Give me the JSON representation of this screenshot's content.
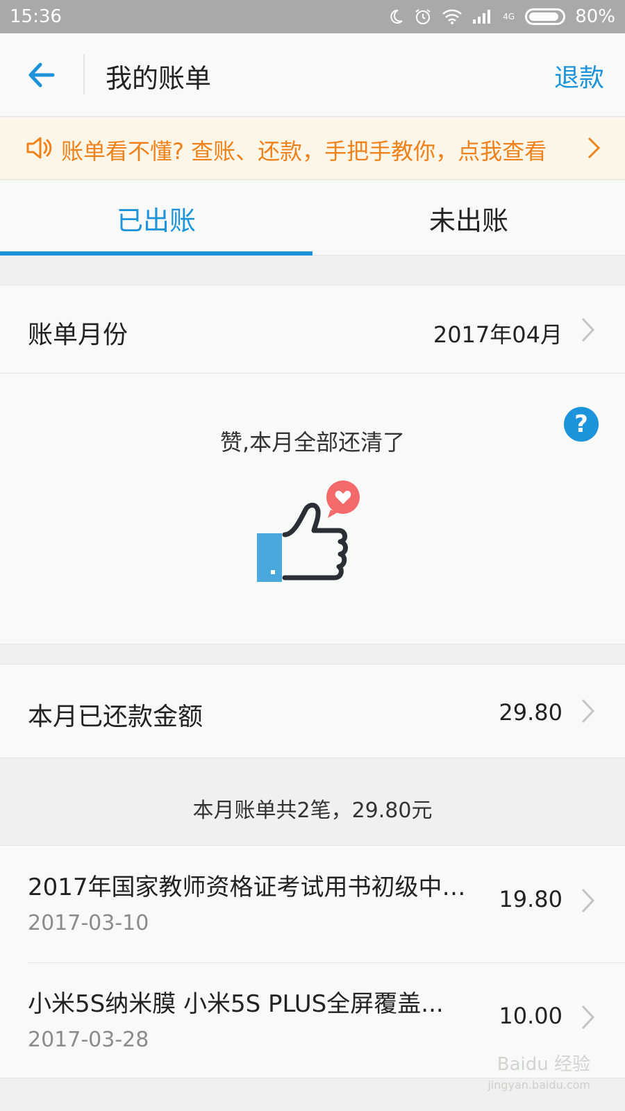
{
  "status_bar": {
    "time": "15:36",
    "network": "4G",
    "battery": "80%"
  },
  "header": {
    "title": "我的账单",
    "refund_label": "退款"
  },
  "notice": {
    "text": "账单看不懂? 查账、还款，手把手教你，点我查看"
  },
  "tabs": [
    {
      "label": "已出账",
      "active": true
    },
    {
      "label": "未出账",
      "active": false
    }
  ],
  "bill_month": {
    "label": "账单月份",
    "value": "2017年04月"
  },
  "status": {
    "message": "赞,本月全部还清了",
    "help_label": "?"
  },
  "paid_amount": {
    "label": "本月已还款金额",
    "value": "29.80"
  },
  "summary": "本月账单共2笔，29.80元",
  "bills": [
    {
      "name": "2017年国家教师资格证考试用书初级中学...",
      "date": "2017-03-10",
      "amount": "19.80"
    },
    {
      "name": "小米5S纳米膜 小米5S PLUS全屏覆盖...",
      "date": "2017-03-28",
      "amount": "10.00"
    }
  ],
  "watermark": {
    "brand": "Baidu 经验",
    "url": "jingyan.baidu.com"
  },
  "colors": {
    "accent": "#1d93dc",
    "notice_text": "#f0811b",
    "notice_bg": "#fbf6e7",
    "heart": "#f46a6a"
  }
}
